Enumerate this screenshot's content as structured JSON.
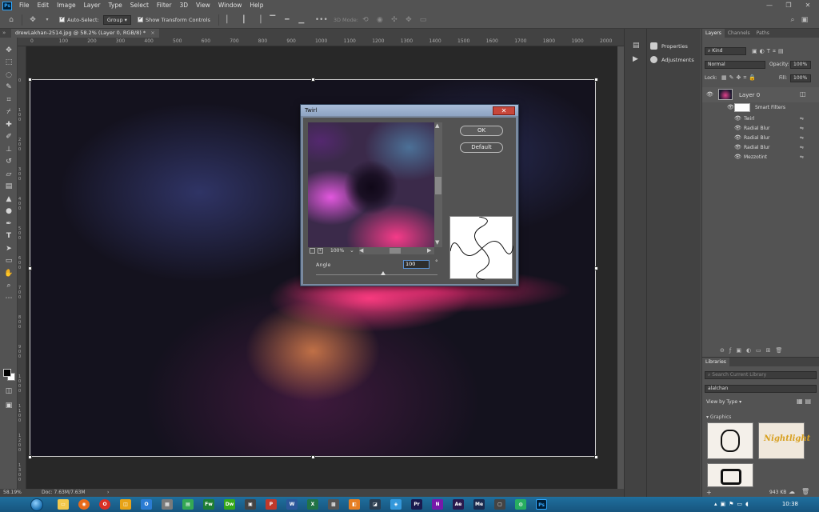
{
  "app": {
    "logo": "Ps"
  },
  "menu": [
    "File",
    "Edit",
    "Image",
    "Layer",
    "Type",
    "Select",
    "Filter",
    "3D",
    "View",
    "Window",
    "Help"
  ],
  "window_controls": {
    "minimize": "—",
    "restore": "❐",
    "close": "✕"
  },
  "options_bar": {
    "auto_select_label": "Auto-Select:",
    "auto_select_value": "Group",
    "show_transform_label": "Show Transform Controls",
    "mode_3d_label": "3D Mode:",
    "more_label": "•••"
  },
  "document": {
    "tab_prefix": "»",
    "tab_title": "drewLakhan-2514.jpg @ 58.2% (Layer 0, RGB/8) *",
    "tab_close": "×"
  },
  "ruler_h_ticks": [
    "0",
    "100",
    "200",
    "300",
    "400",
    "500",
    "600",
    "700",
    "800",
    "900",
    "1000",
    "1100",
    "1200",
    "1300",
    "1400",
    "1500",
    "1600",
    "1700",
    "1800",
    "1900",
    "2000"
  ],
  "ruler_v_ticks": [
    "0",
    "100",
    "200",
    "300",
    "400",
    "500",
    "600",
    "700",
    "800",
    "900",
    "1000",
    "1100",
    "1200",
    "1300"
  ],
  "status": {
    "zoom": "58.19%",
    "doc": "Doc: 7.63M/7.63M",
    "arrow": "›"
  },
  "properties_panel": {
    "items": [
      "Properties",
      "Adjustments"
    ]
  },
  "layers_panel": {
    "tabs": [
      "Layers",
      "Channels",
      "Paths"
    ],
    "kind_label": "Kind",
    "blend_mode": "Normal",
    "opacity_label": "Opacity:",
    "opacity_value": "100%",
    "lock_label": "Lock:",
    "fill_label": "Fill:",
    "fill_value": "100%",
    "layer_name": "Layer 0",
    "smart_filters_label": "Smart Filters",
    "filters": [
      "Twirl",
      "Radial Blur",
      "Radial Blur",
      "Radial Blur",
      "Mezzotint"
    ]
  },
  "libraries_panel": {
    "tab": "Libraries",
    "search_placeholder": "Search Current Library",
    "library_name": "alalchan",
    "view_by": "View by Type",
    "section": "Graphics",
    "size": "943 KB",
    "thumb_text": "Nightlight"
  },
  "dialog": {
    "title": "Twirl",
    "close": "✕",
    "ok_label": "OK",
    "default_label": "Default",
    "zoom_value": "100%",
    "angle_label": "Angle",
    "angle_value": "100",
    "angle_unit": "°",
    "angle_min": -999,
    "angle_max": 999
  },
  "taskbar": {
    "time": "10:38"
  },
  "colors": {
    "ps_blue": "#31a8ff",
    "close_red": "#c7473b",
    "panel": "#535353",
    "dark_panel": "#424242"
  }
}
